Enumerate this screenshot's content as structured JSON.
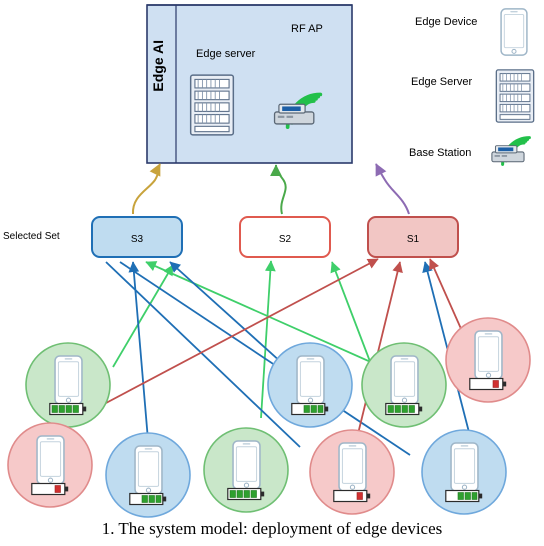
{
  "figure": {
    "caption": "1.  The system model: deployment of edge devices",
    "edge_ai_label": "Edge AI",
    "edge_server_label": "Edge server",
    "rf_ap_label": "RF  AP",
    "selected_set_label": "Selected Set"
  },
  "legend": {
    "items": [
      {
        "label": "Edge Device",
        "icon": "phone-icon"
      },
      {
        "label": "Edge Server",
        "icon": "server-rack-icon"
      },
      {
        "label": "Base Station",
        "icon": "access-point-icon"
      }
    ]
  },
  "selected_nodes": [
    {
      "id": "S3",
      "color": "#1f6fb5",
      "fill": "#bfdcf0"
    },
    {
      "id": "S2",
      "color": "#e05a4f",
      "fill": "#ffffff"
    },
    {
      "id": "S1",
      "color": "#c0504d",
      "fill": "#f2c6c4"
    }
  ],
  "devices": [
    {
      "id": "d1",
      "group": "green",
      "battery": "high"
    },
    {
      "id": "d2",
      "group": "red",
      "battery": "low"
    },
    {
      "id": "d3",
      "group": "blue",
      "battery": "mid"
    },
    {
      "id": "d4",
      "group": "blue",
      "battery": "mid"
    },
    {
      "id": "d5",
      "group": "green",
      "battery": "high"
    },
    {
      "id": "d6",
      "group": "green",
      "battery": "high"
    },
    {
      "id": "d7",
      "group": "red",
      "battery": "low"
    },
    {
      "id": "d8",
      "group": "red",
      "battery": "low"
    },
    {
      "id": "d9",
      "group": "blue",
      "battery": "mid"
    }
  ],
  "colors": {
    "panel_fill": "#cfe0f2",
    "panel_stroke": "#2b3a6b",
    "green_node": "#c9e7c9",
    "green_stroke": "#6fbf73",
    "red_node": "#f6c9c9",
    "red_stroke": "#e08b8b",
    "blue_node": "#bfdcf0",
    "blue_stroke": "#6fa8dc",
    "arrow_green": "#3fcf6a",
    "arrow_blue": "#1f6fb5",
    "arrow_red": "#c0504d",
    "arrow_gold": "#c8a33c",
    "arrow_purple": "#8d6bb3",
    "battery_green": "#2fa02f",
    "battery_red": "#d03030"
  }
}
